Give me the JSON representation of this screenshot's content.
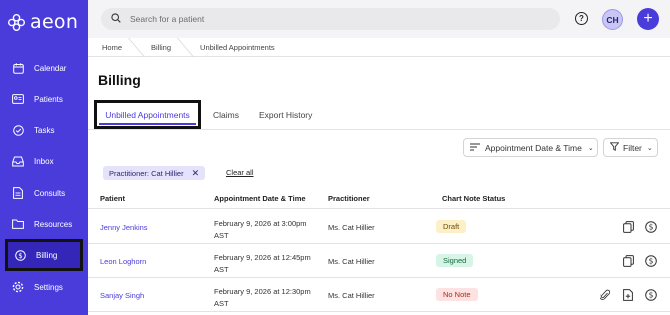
{
  "app": {
    "logo_text": "aeon"
  },
  "sidebar": {
    "items": [
      {
        "label": "Calendar",
        "icon": "calendar-icon"
      },
      {
        "label": "Patients",
        "icon": "id-card-icon"
      },
      {
        "label": "Tasks",
        "icon": "check-circle-icon"
      },
      {
        "label": "Inbox",
        "icon": "inbox-icon"
      },
      {
        "label": "Consults",
        "icon": "document-icon"
      },
      {
        "label": "Resources",
        "icon": "folder-icon"
      },
      {
        "label": "Billing",
        "icon": "dollar-circle-icon",
        "active": true
      },
      {
        "label": "Settings",
        "icon": "gear-icon"
      }
    ]
  },
  "topbar": {
    "search_placeholder": "Search for a patient",
    "help_label": "?",
    "avatar_initials": "CH",
    "add_label": "+"
  },
  "breadcrumb": [
    "Home",
    "Billing",
    "Unbilled Appointments"
  ],
  "page": {
    "title": "Billing"
  },
  "tabs": [
    {
      "label": "Unbilled Appointments",
      "active": true
    },
    {
      "label": "Claims"
    },
    {
      "label": "Export History"
    }
  ],
  "toolbar": {
    "sort_label": "Appointment Date & Time",
    "filter_label": "Filter"
  },
  "filters": {
    "chips": [
      {
        "label": "Practitioner: Cat Hillier"
      }
    ],
    "clear_label": "Clear all"
  },
  "table": {
    "columns": [
      "Patient",
      "Appointment Date & Time",
      "Practitioner",
      "Chart Note Status"
    ],
    "rows": [
      {
        "patient": "Jenny Jenkins",
        "date_line1": "February 9, 2026 at 3:00pm",
        "date_line2": "AST",
        "practitioner": "Ms. Cat Hillier",
        "status": "Draft",
        "status_type": "draft",
        "actions": [
          "copy-icon",
          "dollar-circle-icon"
        ]
      },
      {
        "patient": "Leon Loghorn",
        "date_line1": "February 9, 2026 at 12:45pm",
        "date_line2": "AST",
        "practitioner": "Ms. Cat Hillier",
        "status": "Signed",
        "status_type": "signed",
        "actions": [
          "copy-icon",
          "dollar-circle-icon"
        ]
      },
      {
        "patient": "Sanjay Singh",
        "date_line1": "February 9, 2026 at 12:30pm",
        "date_line2": "AST",
        "practitioner": "Ms. Cat Hillier",
        "status": "No Note",
        "status_type": "nonote",
        "actions": [
          "paperclip-icon",
          "file-plus-icon",
          "dollar-circle-icon"
        ]
      }
    ]
  },
  "colors": {
    "brand": "#4a3cdb",
    "sidebar_active": "#3326b8"
  }
}
